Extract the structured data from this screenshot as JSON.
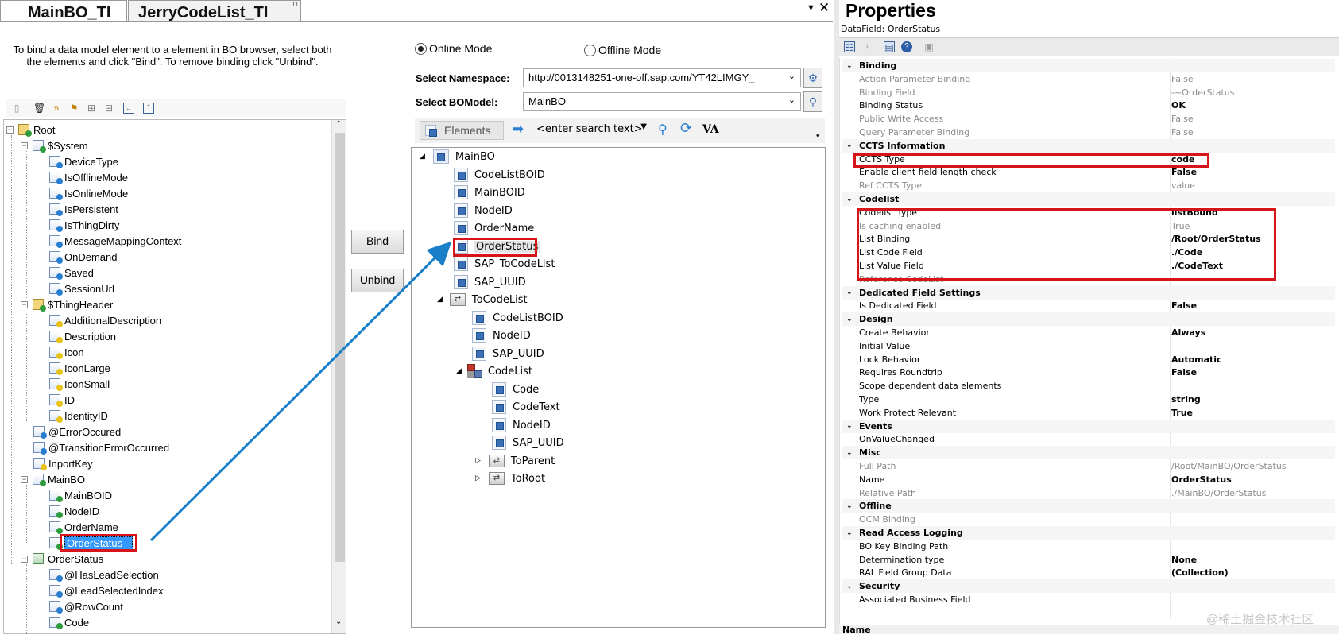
{
  "tabs": [
    {
      "label": "MainBO_TI"
    },
    {
      "label": "JerryCodeList_TI"
    }
  ],
  "left": {
    "instructions": "To bind a data model element to a element in BO browser, select both the elements and click \"Bind\". To remove binding click \"Unbind\".",
    "tree": [
      {
        "label": "Root"
      },
      {
        "label": "$System"
      },
      {
        "label": "DeviceType"
      },
      {
        "label": "IsOfflineMode"
      },
      {
        "label": "IsOnlineMode"
      },
      {
        "label": "IsPersistent"
      },
      {
        "label": "IsThingDirty"
      },
      {
        "label": "MessageMappingContext"
      },
      {
        "label": "OnDemand"
      },
      {
        "label": "Saved"
      },
      {
        "label": "SessionUrl"
      },
      {
        "label": "$ThingHeader"
      },
      {
        "label": "AdditionalDescription"
      },
      {
        "label": "Description"
      },
      {
        "label": "Icon"
      },
      {
        "label": "IconLarge"
      },
      {
        "label": "IconSmall"
      },
      {
        "label": "ID"
      },
      {
        "label": "IdentityID"
      },
      {
        "label": "@ErrorOccured"
      },
      {
        "label": "@TransitionErrorOccurred"
      },
      {
        "label": "InportKey"
      },
      {
        "label": "MainBO"
      },
      {
        "label": "MainBOID"
      },
      {
        "label": "NodeID"
      },
      {
        "label": "OrderName"
      },
      {
        "label": "OrderStatus"
      },
      {
        "label": "OrderStatus"
      },
      {
        "label": "@HasLeadSelection"
      },
      {
        "label": "@LeadSelectedIndex"
      },
      {
        "label": "@RowCount"
      },
      {
        "label": "Code"
      }
    ]
  },
  "buttons": {
    "bind": "Bind",
    "unbind": "Unbind"
  },
  "mode": {
    "online": "Online Mode",
    "offline": "Offline Mode",
    "selected": "online"
  },
  "namespace": {
    "label": "Select Namespace:",
    "value": "http://0013148251-one-off.sap.com/YT42LIMGY_"
  },
  "bomodel": {
    "label": "Select BOModel:",
    "value": "MainBO"
  },
  "browser": {
    "elements_label": "Elements",
    "search_placeholder": "<enter search text>",
    "va_label": "VA",
    "tree": [
      {
        "label": "MainBO"
      },
      {
        "label": "CodeListBOID"
      },
      {
        "label": "MainBOID"
      },
      {
        "label": "NodeID"
      },
      {
        "label": "OrderName"
      },
      {
        "label": "OrderStatus"
      },
      {
        "label": "SAP_ToCodeList"
      },
      {
        "label": "SAP_UUID"
      },
      {
        "label": "ToCodeList"
      },
      {
        "label": "CodeListBOID"
      },
      {
        "label": "NodeID"
      },
      {
        "label": "SAP_UUID"
      },
      {
        "label": "CodeList"
      },
      {
        "label": "Code"
      },
      {
        "label": "CodeText"
      },
      {
        "label": "NodeID"
      },
      {
        "label": "SAP_UUID"
      },
      {
        "label": "ToParent"
      },
      {
        "label": "ToRoot"
      }
    ]
  },
  "properties": {
    "title": "Properties",
    "subtitle": "DataField: OrderStatus",
    "rows": [
      {
        "cat": "Binding"
      },
      {
        "name": "Action Parameter Binding",
        "value": "False",
        "gray": true
      },
      {
        "name": "Binding Field",
        "value": "-~OrderStatus",
        "gray": true
      },
      {
        "name": "Binding Status",
        "value": "OK"
      },
      {
        "name": "Public Write Access",
        "value": "False",
        "gray": true
      },
      {
        "name": "Query Parameter Binding",
        "value": "False",
        "gray": true
      },
      {
        "cat": "CCTS Information"
      },
      {
        "name": "CCTS Type",
        "value": "code"
      },
      {
        "name": "Enable client field length check",
        "value": "False"
      },
      {
        "name": "Ref CCTS Type",
        "value": "value",
        "gray": true
      },
      {
        "cat": "Codelist"
      },
      {
        "name": "Codelist Type",
        "value": "listBound"
      },
      {
        "name": "Is caching enabled",
        "value": "True",
        "gray": true
      },
      {
        "name": "List Binding",
        "value": "/Root/OrderStatus"
      },
      {
        "name": "List Code Field",
        "value": "./Code"
      },
      {
        "name": "List Value Field",
        "value": "./CodeText"
      },
      {
        "name": "Reference CodeList",
        "value": "",
        "gray": true
      },
      {
        "cat": "Dedicated Field Settings"
      },
      {
        "name": "Is Dedicated Field",
        "value": "False"
      },
      {
        "cat": "Design"
      },
      {
        "name": "Create Behavior",
        "value": "Always"
      },
      {
        "name": "Initial Value",
        "value": ""
      },
      {
        "name": "Lock Behavior",
        "value": "Automatic"
      },
      {
        "name": "Requires Roundtrip",
        "value": "False"
      },
      {
        "name": "Scope dependent data elements",
        "value": ""
      },
      {
        "name": "Type",
        "value": "string"
      },
      {
        "name": "Work Protect Relevant",
        "value": "True"
      },
      {
        "cat": "Events"
      },
      {
        "name": "OnValueChanged",
        "value": ""
      },
      {
        "cat": "Misc"
      },
      {
        "name": "Full Path",
        "value": "/Root/MainBO/OrderStatus",
        "gray": true
      },
      {
        "name": "Name",
        "value": "OrderStatus"
      },
      {
        "name": "Relative Path",
        "value": "./MainBO/OrderStatus",
        "gray": true
      },
      {
        "cat": "Offline"
      },
      {
        "name": "OCM Binding",
        "value": "",
        "gray": true
      },
      {
        "cat": "Read Access Logging"
      },
      {
        "name": "BO Key Binding Path",
        "value": ""
      },
      {
        "name": "Determination type",
        "value": "None"
      },
      {
        "name": "RAL Field Group Data",
        "value": "(Collection)"
      },
      {
        "cat": "Security"
      },
      {
        "name": "Associated Business Field",
        "value": ""
      }
    ],
    "footer": "Name"
  },
  "watermark": "@稀土掘金技术社区",
  "colors": {
    "highlight": "#3399ff",
    "annotation_red": "#d7141a",
    "arrow": "#1a7fc9"
  }
}
